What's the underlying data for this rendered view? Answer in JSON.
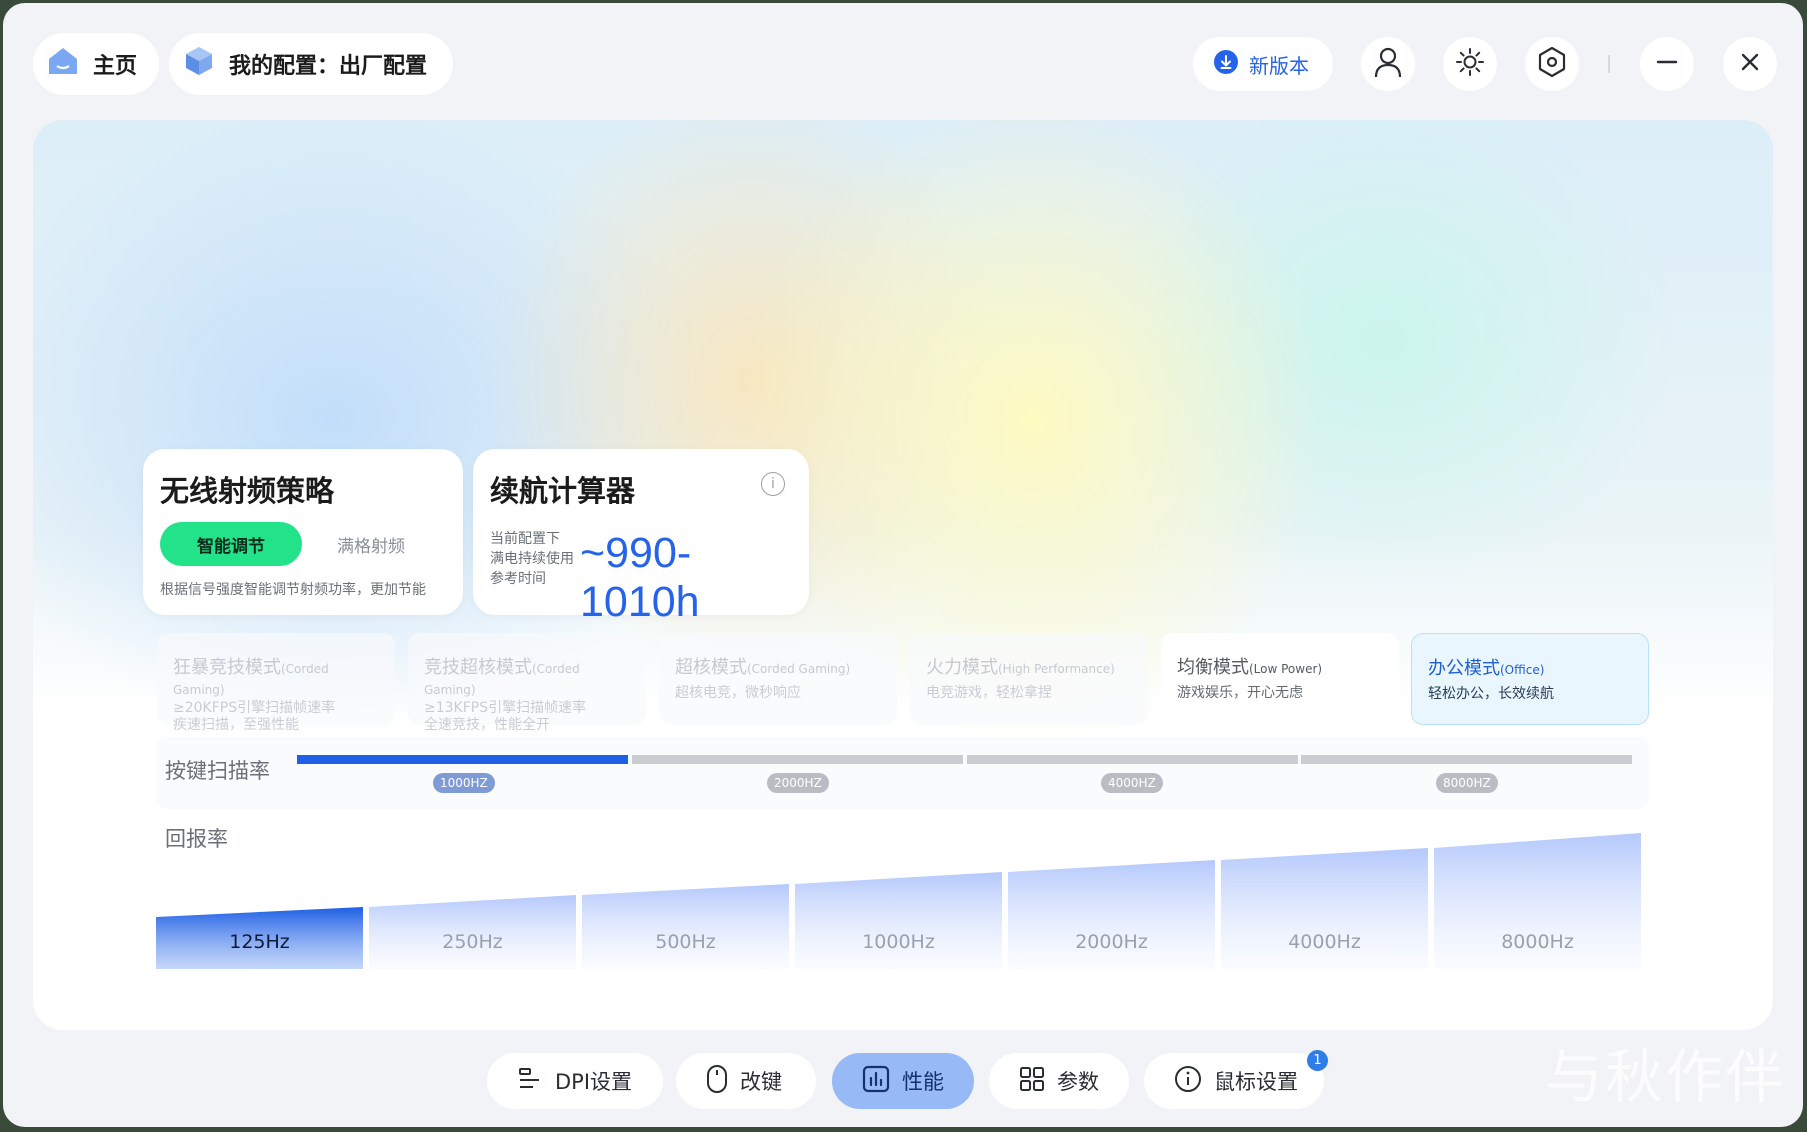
{
  "header": {
    "home_label": "主页",
    "config_label": "我的配置：出厂配置",
    "update_label": "新版本"
  },
  "wireless": {
    "title": "无线射频策略",
    "option_on": "智能调节",
    "option_off": "满格射频",
    "desc": "根据信号强度智能调节射频功率，更加节能"
  },
  "battery": {
    "title": "续航计算器",
    "info": "i",
    "line1": "当前配置下",
    "line2": "满电持续使用",
    "line3": "参考时间",
    "value": "~990-1010h"
  },
  "modes": [
    {
      "name": "狂暴竞技模式",
      "en": "(Corded Gaming)",
      "sub1": "≥20KFPS引擎扫描帧速率",
      "sub2": "疾速扫描，至强性能"
    },
    {
      "name": "竞技超核模式",
      "en": "(Corded Gaming)",
      "sub1": "≥13KFPS引擎扫描帧速率",
      "sub2": "全速竞技，性能全开"
    },
    {
      "name": "超核模式",
      "en": "(Corded Gaming)",
      "sub1": "超核电竞，微秒响应",
      "sub2": ""
    },
    {
      "name": "火力模式",
      "en": "(High Performance)",
      "sub1": "电竞游戏，轻松拿捏",
      "sub2": ""
    },
    {
      "name": "均衡模式",
      "en": "(Low Power)",
      "sub1": "游戏娱乐，开心无虑",
      "sub2": ""
    },
    {
      "name": "办公模式",
      "en": "(Office)",
      "sub1": "轻松办公，长效续航",
      "sub2": ""
    }
  ],
  "scan": {
    "label": "按键扫描率",
    "ticks": [
      "1000HZ",
      "2000HZ",
      "4000HZ",
      "8000HZ"
    ],
    "selected_index": 0
  },
  "report": {
    "label": "回报率",
    "rates": [
      "125Hz",
      "250Hz",
      "500Hz",
      "1000Hz",
      "2000Hz",
      "4000Hz",
      "8000Hz"
    ],
    "selected_index": 0
  },
  "nav": {
    "dpi": "DPI设置",
    "remap": "改键",
    "perf": "性能",
    "params": "参数",
    "mouse": "鼠标设置",
    "badge": "1"
  },
  "watermark": "与秋作伴",
  "colors": {
    "accent": "#2563eb",
    "toggle_on": "#22e38a",
    "nav_active": "#97b9f5"
  }
}
